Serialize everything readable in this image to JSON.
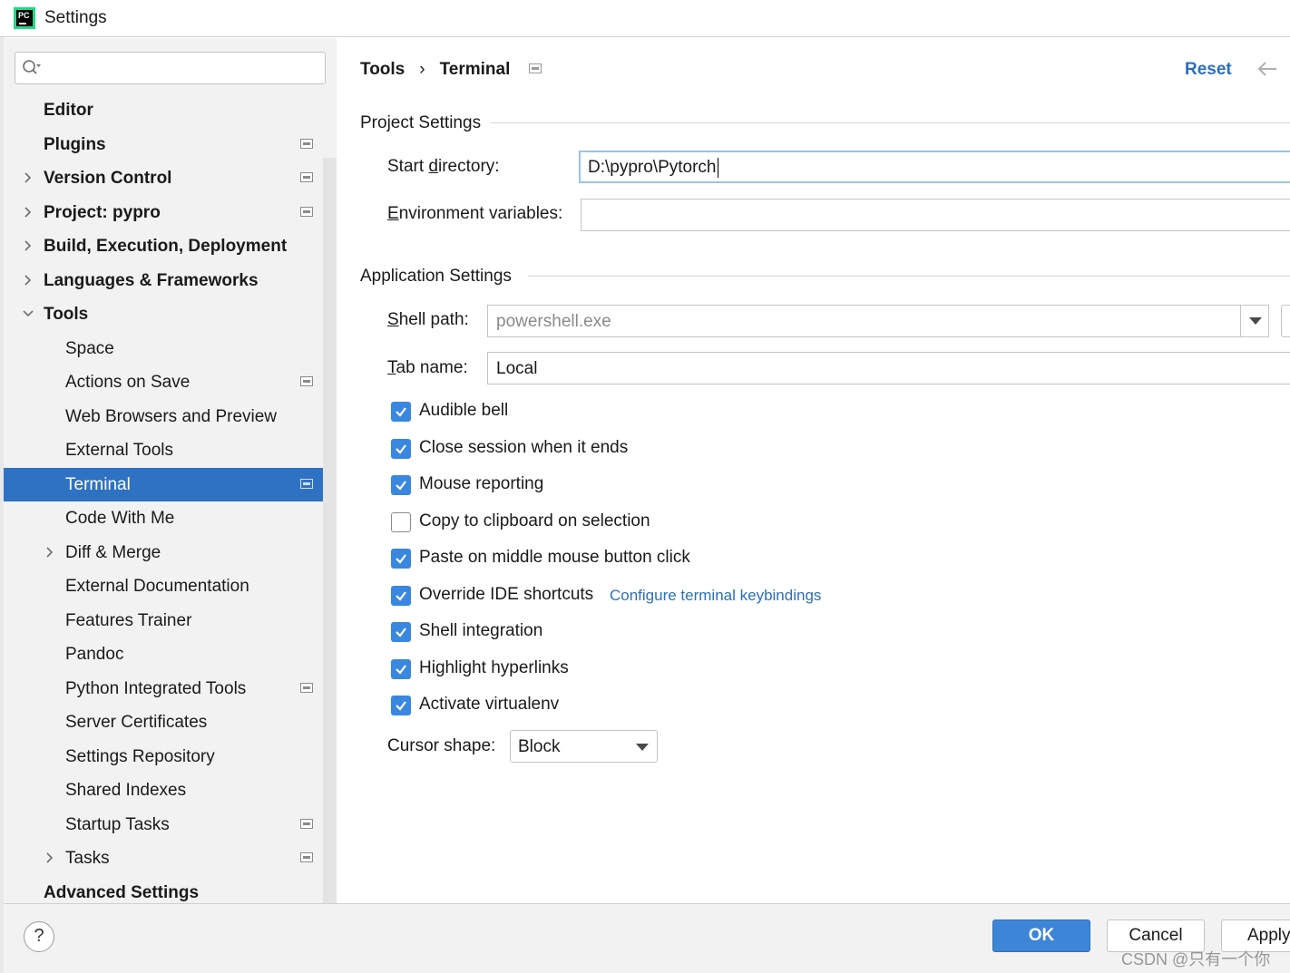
{
  "window": {
    "title": "Settings",
    "app_icon": "pycharm-logo"
  },
  "sidebar": {
    "search": {
      "placeholder": "",
      "value": ""
    },
    "items": [
      {
        "label": "Editor",
        "bold": true,
        "level": 0,
        "expandable": false,
        "project_icon": false
      },
      {
        "label": "Plugins",
        "bold": true,
        "level": 0,
        "expandable": false,
        "project_icon": true
      },
      {
        "label": "Version Control",
        "bold": true,
        "level": 0,
        "expandable": true,
        "expanded": false,
        "project_icon": true
      },
      {
        "label": "Project: pypro",
        "bold": true,
        "level": 0,
        "expandable": true,
        "expanded": false,
        "project_icon": true
      },
      {
        "label": "Build, Execution, Deployment",
        "bold": true,
        "level": 0,
        "expandable": true,
        "expanded": false,
        "project_icon": false
      },
      {
        "label": "Languages & Frameworks",
        "bold": true,
        "level": 0,
        "expandable": true,
        "expanded": false,
        "project_icon": false
      },
      {
        "label": "Tools",
        "bold": true,
        "level": 0,
        "expandable": true,
        "expanded": true,
        "project_icon": false
      },
      {
        "label": "Space",
        "bold": false,
        "level": 1,
        "expandable": false,
        "project_icon": false
      },
      {
        "label": "Actions on Save",
        "bold": false,
        "level": 1,
        "expandable": false,
        "project_icon": true
      },
      {
        "label": "Web Browsers and Preview",
        "bold": false,
        "level": 1,
        "expandable": false,
        "project_icon": false
      },
      {
        "label": "External Tools",
        "bold": false,
        "level": 1,
        "expandable": false,
        "project_icon": false
      },
      {
        "label": "Terminal",
        "bold": false,
        "level": 1,
        "expandable": false,
        "project_icon": true,
        "selected": true
      },
      {
        "label": "Code With Me",
        "bold": false,
        "level": 1,
        "expandable": false,
        "project_icon": false
      },
      {
        "label": "Diff & Merge",
        "bold": false,
        "level": 1,
        "expandable": true,
        "expanded": false,
        "project_icon": false
      },
      {
        "label": "External Documentation",
        "bold": false,
        "level": 1,
        "expandable": false,
        "project_icon": false
      },
      {
        "label": "Features Trainer",
        "bold": false,
        "level": 1,
        "expandable": false,
        "project_icon": false
      },
      {
        "label": "Pandoc",
        "bold": false,
        "level": 1,
        "expandable": false,
        "project_icon": false
      },
      {
        "label": "Python Integrated Tools",
        "bold": false,
        "level": 1,
        "expandable": false,
        "project_icon": true
      },
      {
        "label": "Server Certificates",
        "bold": false,
        "level": 1,
        "expandable": false,
        "project_icon": false
      },
      {
        "label": "Settings Repository",
        "bold": false,
        "level": 1,
        "expandable": false,
        "project_icon": false
      },
      {
        "label": "Shared Indexes",
        "bold": false,
        "level": 1,
        "expandable": false,
        "project_icon": false
      },
      {
        "label": "Startup Tasks",
        "bold": false,
        "level": 1,
        "expandable": false,
        "project_icon": true
      },
      {
        "label": "Tasks",
        "bold": false,
        "level": 1,
        "expandable": true,
        "expanded": false,
        "project_icon": true
      },
      {
        "label": "Advanced Settings",
        "bold": true,
        "level": 0,
        "expandable": false,
        "project_icon": false
      }
    ]
  },
  "header": {
    "breadcrumb": [
      "Tools",
      "Terminal"
    ],
    "separator": "›",
    "reset_label": "Reset"
  },
  "project_settings": {
    "title": "Project Settings",
    "start_directory": {
      "label_pre": "Start ",
      "label_u": "d",
      "label_post": "irectory:",
      "value": "D:\\pypro\\Pytorch"
    },
    "environment_variables": {
      "label_pre": "",
      "label_u": "E",
      "label_post": "nvironment variables:",
      "value": ""
    }
  },
  "application_settings": {
    "title": "Application Settings",
    "shell_path": {
      "label_pre": "",
      "label_u": "S",
      "label_post": "hell path:",
      "placeholder": "powershell.exe"
    },
    "tab_name": {
      "label_pre": "",
      "label_u": "T",
      "label_post": "ab name:",
      "value": "Local"
    },
    "checkboxes": [
      {
        "label": "Audible bell",
        "checked": true
      },
      {
        "label": "Close session when it ends",
        "checked": true
      },
      {
        "label": "Mouse reporting",
        "checked": true
      },
      {
        "label": "Copy to clipboard on selection",
        "checked": false
      },
      {
        "label": "Paste on middle mouse button click",
        "checked": true
      },
      {
        "label": "Override IDE shortcuts",
        "checked": true,
        "link": "Configure terminal keybindings"
      },
      {
        "label": "Shell integration",
        "checked": true
      },
      {
        "label": "Highlight hyperlinks",
        "checked": true
      },
      {
        "label": "Activate virtualenv",
        "checked": true
      }
    ],
    "cursor_shape": {
      "label": "Cursor shape:",
      "value": "Block"
    }
  },
  "footer": {
    "help_label": "?",
    "ok_label": "OK",
    "cancel_label": "Cancel",
    "apply_label": "Apply",
    "watermark": "CSDN @只有一个你"
  },
  "colors": {
    "selection": "#2f72c3",
    "checkbox": "#3a87e0",
    "link": "#2a6fbe",
    "primary_button": "#3d85d6"
  }
}
